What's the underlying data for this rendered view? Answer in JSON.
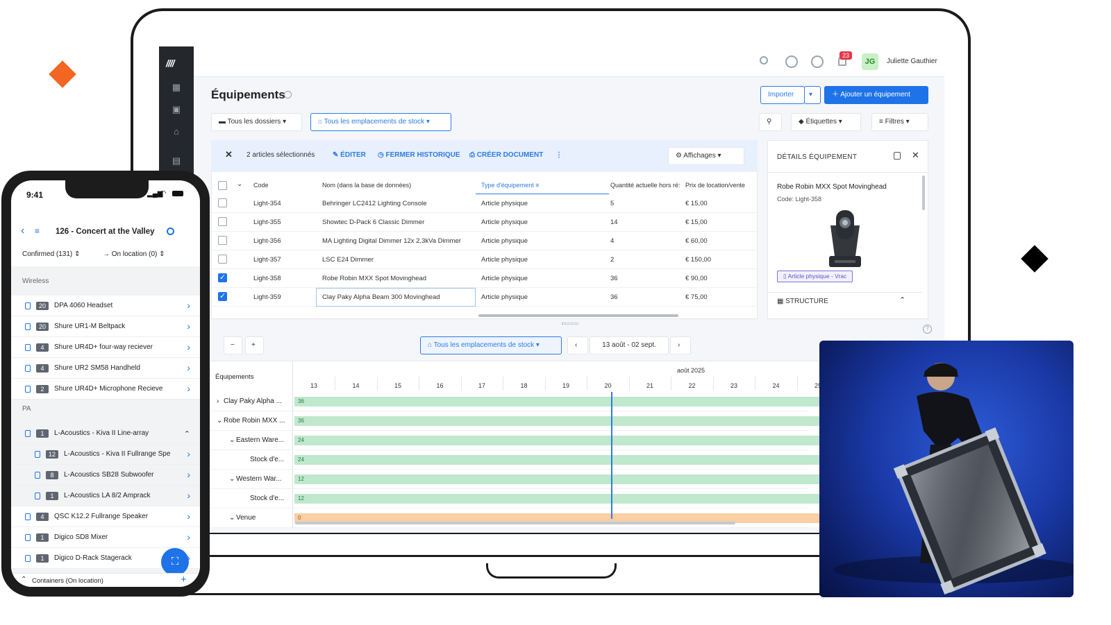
{
  "colors": {
    "accent": "#1e73e8",
    "orange": "#f26522",
    "bar_green": "#bfe8cd",
    "bar_orange": "#f9cfa3",
    "today_line": "#2c7be5"
  },
  "topbar": {
    "notifications": "23",
    "avatar": "JG",
    "user": "Juliette Gauthier"
  },
  "page": {
    "title": "Équipements",
    "import_label": "Importer",
    "add_label": "Ajouter un équipement",
    "folders_label": "Tous les dossiers",
    "locations_label": "Tous les emplacements de stock",
    "tags_label": "Étiquettes",
    "filters_label": "Filtres"
  },
  "selection": {
    "count_label": "2 articles sélectionnés",
    "edit_label": "ÉDITER",
    "history_label": "FERMER HISTORIQUE",
    "doc_label": "CRÉER DOCUMENT",
    "views_label": "Affichages"
  },
  "table": {
    "headers": [
      "Code",
      "Nom (dans la base de données)",
      "Type d'équipement",
      "Quantité actuelle hors ré:",
      "Prix de location/vente"
    ],
    "rows": [
      {
        "code": "Light-354",
        "name": "Behringer LC2412 Lighting Console",
        "type": "Article physique",
        "qty": "5",
        "price": "€ 15,00",
        "checked": false
      },
      {
        "code": "Light-355",
        "name": "Showtec D-Pack 6 Classic Dimmer",
        "type": "Article physique",
        "qty": "14",
        "price": "€ 15,00",
        "checked": false
      },
      {
        "code": "Light-356",
        "name": "MA Lighting Digital Dimmer 12x 2,3kVa Dimmer",
        "type": "Article physique",
        "qty": "4",
        "price": "€ 60,00",
        "checked": false
      },
      {
        "code": "Light-357",
        "name": "LSC E24 Dimmer",
        "type": "Article physique",
        "qty": "2",
        "price": "€ 150,00",
        "checked": false
      },
      {
        "code": "Light-358",
        "name": "Robe Robin MXX Spot Movinghead",
        "type": "Article physique",
        "qty": "36",
        "price": "€ 90,00",
        "checked": true
      },
      {
        "code": "Light-359",
        "name": "Clay Paky Alpha Beam 300 Movinghead",
        "type": "Article physique",
        "qty": "36",
        "price": "€ 75,00",
        "checked": true
      }
    ]
  },
  "details": {
    "header": "DÉTAILS ÉQUIPEMENT",
    "name": "Robe Robin MXX Spot Movinghead",
    "code": "Code: Light-358",
    "tag": "Article physique - Vrac",
    "structure": "STRUCTURE"
  },
  "planning": {
    "locations_label": "Tous les emplacements de stock",
    "range": "13 août - 02 sept.",
    "column_label": "Équipements",
    "month": "août 2025",
    "days": [
      "13",
      "14",
      "15",
      "16",
      "17",
      "18",
      "19",
      "20",
      "21",
      "22",
      "23",
      "24",
      "25"
    ],
    "rows": [
      {
        "label": "Clay Paky Alpha ...",
        "value": "36",
        "indent": 0,
        "caret": "›"
      },
      {
        "label": "Robe Robin MXX ...",
        "value": "36",
        "indent": 0,
        "caret": "⌄"
      },
      {
        "label": "Eastern Ware...",
        "value": "24",
        "indent": 1,
        "caret": "⌄"
      },
      {
        "label": "Stock d'e...",
        "value": "24",
        "indent": 2,
        "caret": ""
      },
      {
        "label": "Western War...",
        "value": "12",
        "indent": 1,
        "caret": "⌄"
      },
      {
        "label": "Stock d'e...",
        "value": "12",
        "indent": 2,
        "caret": ""
      },
      {
        "label": "Venue",
        "value": "0",
        "indent": 1,
        "caret": "⌄"
      }
    ]
  },
  "phone": {
    "time": "9:41",
    "project": "126 - Concert at the Valley",
    "confirmed": "Confirmed (131)",
    "on_location": "On location (0)",
    "sections": [
      {
        "title": "Wireless",
        "items": [
          {
            "qty": "20",
            "name": "DPA 4060 Headset"
          },
          {
            "qty": "20",
            "name": "Shure UR1-M Beltpack"
          },
          {
            "qty": "4",
            "name": "Shure UR4D+ four-way reciever"
          },
          {
            "qty": "4",
            "name": "Shure UR2 SM58 Handheld"
          },
          {
            "qty": "2",
            "name": "Shure UR4D+ Microphone Recieve"
          }
        ]
      },
      {
        "title": "PA",
        "items": [
          {
            "qty": "1",
            "name": "L-Acoustics - Kiva II Line-array"
          },
          {
            "qty": "12",
            "name": "L-Acoustics - Kiva II Fullrange Spe"
          },
          {
            "qty": "8",
            "name": "L-Acoustics SB28 Subwoofer"
          },
          {
            "qty": "1",
            "name": "L-Acoustics LA 8/2 Amprack"
          },
          {
            "qty": "4",
            "name": "QSC K12.2 Fullrange Speaker"
          },
          {
            "qty": "1",
            "name": "Digico SD8 Mixer"
          },
          {
            "qty": "1",
            "name": "Digico D-Rack Stagerack"
          }
        ]
      }
    ],
    "footer": "Containers (On location)"
  }
}
